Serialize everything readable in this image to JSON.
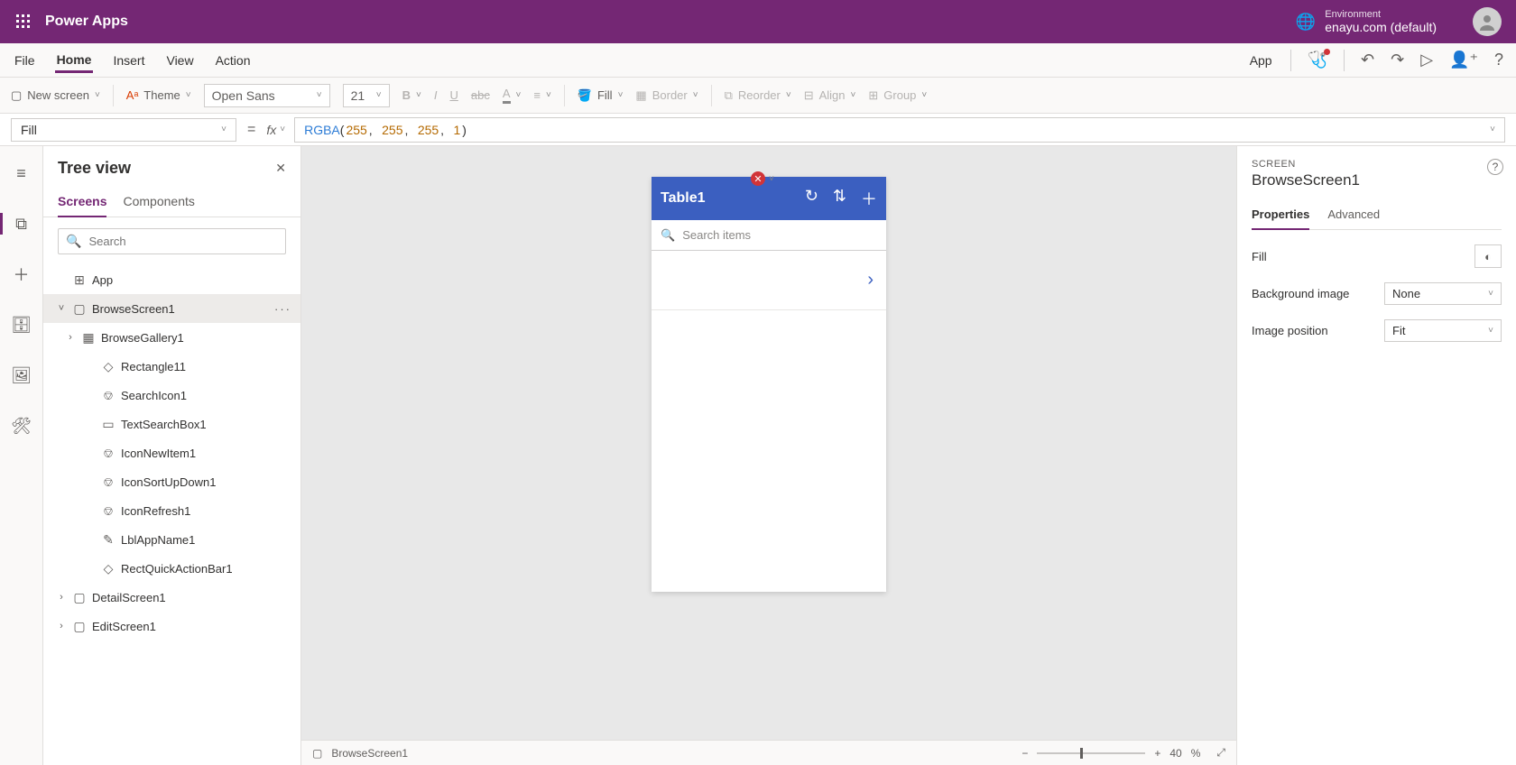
{
  "topbar": {
    "app_name": "Power Apps",
    "env_label": "Environment",
    "env_name": "enayu.com (default)"
  },
  "menubar": {
    "items": [
      "File",
      "Home",
      "Insert",
      "View",
      "Action"
    ],
    "active_index": 1,
    "app_label": "App"
  },
  "ribbon": {
    "new_screen": "New screen",
    "theme": "Theme",
    "font": "Open Sans",
    "font_size": "21",
    "fill": "Fill",
    "border": "Border",
    "reorder": "Reorder",
    "align": "Align",
    "group": "Group"
  },
  "formula": {
    "property": "Fill",
    "fn": "RGBA",
    "args": [
      "255",
      "255",
      "255",
      "1"
    ]
  },
  "tree": {
    "title": "Tree view",
    "tabs": [
      "Screens",
      "Components"
    ],
    "active_tab": 0,
    "search_placeholder": "Search",
    "items": [
      {
        "label": "App",
        "level": 0,
        "exp": "",
        "icon": "⊞"
      },
      {
        "label": "BrowseScreen1",
        "level": 0,
        "exp": "˅",
        "icon": "▢",
        "selected": true
      },
      {
        "label": "BrowseGallery1",
        "level": 1,
        "exp": "›",
        "icon": "▦"
      },
      {
        "label": "Rectangle11",
        "level": 2,
        "exp": "",
        "icon": "◇"
      },
      {
        "label": "SearchIcon1",
        "level": 2,
        "exp": "",
        "icon": "⎊"
      },
      {
        "label": "TextSearchBox1",
        "level": 2,
        "exp": "",
        "icon": "▭"
      },
      {
        "label": "IconNewItem1",
        "level": 2,
        "exp": "",
        "icon": "⎊"
      },
      {
        "label": "IconSortUpDown1",
        "level": 2,
        "exp": "",
        "icon": "⎊"
      },
      {
        "label": "IconRefresh1",
        "level": 2,
        "exp": "",
        "icon": "⎊"
      },
      {
        "label": "LblAppName1",
        "level": 2,
        "exp": "",
        "icon": "✎"
      },
      {
        "label": "RectQuickActionBar1",
        "level": 2,
        "exp": "",
        "icon": "◇"
      },
      {
        "label": "DetailScreen1",
        "level": 0,
        "exp": "›",
        "icon": "▢"
      },
      {
        "label": "EditScreen1",
        "level": 0,
        "exp": "›",
        "icon": "▢"
      }
    ]
  },
  "phone": {
    "title": "Table1",
    "search_placeholder": "Search items"
  },
  "status": {
    "screen": "BrowseScreen1",
    "zoom_value": "40",
    "zoom_unit": "%"
  },
  "props": {
    "category": "SCREEN",
    "name": "BrowseScreen1",
    "tabs": [
      "Properties",
      "Advanced"
    ],
    "active_tab": 0,
    "fill_label": "Fill",
    "bg_label": "Background image",
    "bg_value": "None",
    "pos_label": "Image position",
    "pos_value": "Fit"
  }
}
